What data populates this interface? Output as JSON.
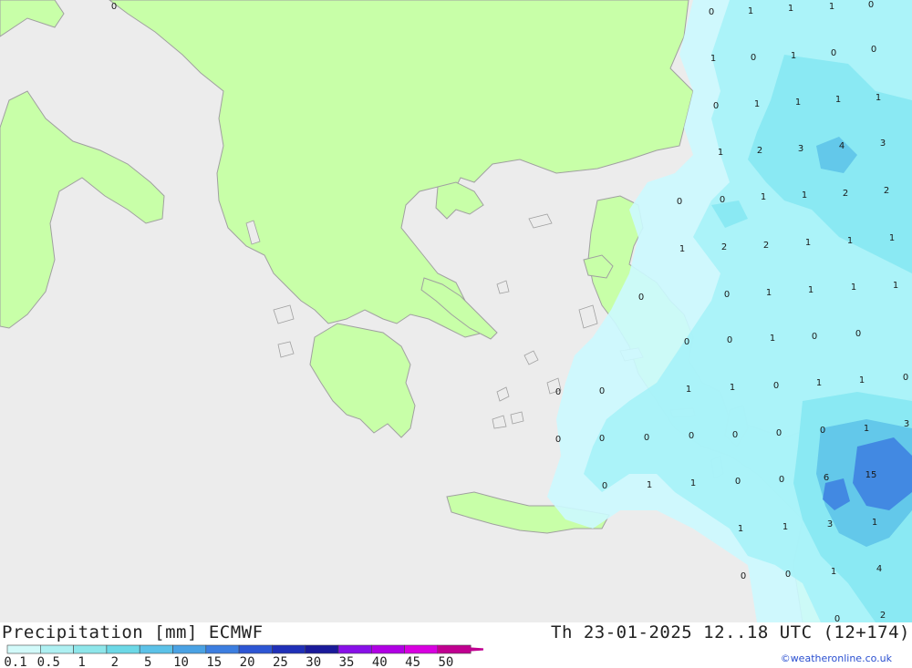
{
  "header": {
    "title": "Precipitation [mm] ECMWF",
    "datetime": "Th 23-01-2025 12..18 UTC (12+174)"
  },
  "credit": "©weatheronline.co.uk",
  "colors": {
    "sea": "#ececec",
    "land": "#c8ffa8",
    "border": "#a0a0a0",
    "precip_light": "#ccfaff",
    "precip_mid": "#a6f2f8",
    "precip_high": "#86e8f2"
  },
  "legend": {
    "labels": [
      "0.1",
      "0.5",
      "1",
      "2",
      "5",
      "10",
      "15",
      "20",
      "25",
      "30",
      "35",
      "40",
      "45",
      "50"
    ],
    "colors": [
      "#d2fafa",
      "#aef0f2",
      "#8ee6ea",
      "#6cd8e6",
      "#5cc2e8",
      "#4aa2e4",
      "#3c7ee0",
      "#2d56d4",
      "#2030b8",
      "#1a1a9a",
      "#8810e8",
      "#b000e4",
      "#d800e0",
      "#c00090"
    ]
  },
  "grid_values": [
    {
      "v": "0",
      "lon_lat": "NW corner"
    },
    {
      "v": "0"
    },
    {
      "v": "1"
    },
    {
      "v": "1"
    },
    {
      "v": "1"
    },
    {
      "v": "0"
    },
    {
      "v": "1"
    },
    {
      "v": "0"
    },
    {
      "v": "1"
    },
    {
      "v": "0"
    },
    {
      "v": "0"
    },
    {
      "v": "0"
    },
    {
      "v": "1"
    },
    {
      "v": "1"
    },
    {
      "v": "1"
    },
    {
      "v": "1"
    },
    {
      "v": "1"
    },
    {
      "v": "2"
    },
    {
      "v": "3"
    },
    {
      "v": "4"
    },
    {
      "v": "3"
    },
    {
      "v": "0"
    },
    {
      "v": "0"
    },
    {
      "v": "1"
    },
    {
      "v": "1"
    },
    {
      "v": "2"
    },
    {
      "v": "2"
    },
    {
      "v": "1"
    },
    {
      "v": "2"
    },
    {
      "v": "2"
    },
    {
      "v": "1"
    },
    {
      "v": "1"
    },
    {
      "v": "1"
    },
    {
      "v": "0"
    },
    {
      "v": "0"
    },
    {
      "v": "1"
    },
    {
      "v": "1"
    },
    {
      "v": "1"
    },
    {
      "v": "1"
    },
    {
      "v": "0"
    },
    {
      "v": "0"
    },
    {
      "v": "1"
    },
    {
      "v": "0"
    },
    {
      "v": "0"
    },
    {
      "v": "0"
    },
    {
      "v": "0"
    },
    {
      "v": "1"
    },
    {
      "v": "1"
    },
    {
      "v": "0"
    },
    {
      "v": "1"
    },
    {
      "v": "1"
    },
    {
      "v": "0"
    },
    {
      "v": "0"
    },
    {
      "v": "0"
    },
    {
      "v": "0"
    },
    {
      "v": "0"
    },
    {
      "v": "0"
    },
    {
      "v": "0"
    },
    {
      "v": "0"
    },
    {
      "v": "1"
    },
    {
      "v": "3"
    },
    {
      "v": "0"
    },
    {
      "v": "1"
    },
    {
      "v": "1"
    },
    {
      "v": "0"
    },
    {
      "v": "0"
    },
    {
      "v": "6"
    },
    {
      "v": "15"
    },
    {
      "v": "1"
    },
    {
      "v": "1"
    },
    {
      "v": "3"
    },
    {
      "v": "1"
    },
    {
      "v": "0"
    },
    {
      "v": "0"
    },
    {
      "v": "1"
    },
    {
      "v": "4"
    },
    {
      "v": "0"
    },
    {
      "v": "2"
    }
  ]
}
